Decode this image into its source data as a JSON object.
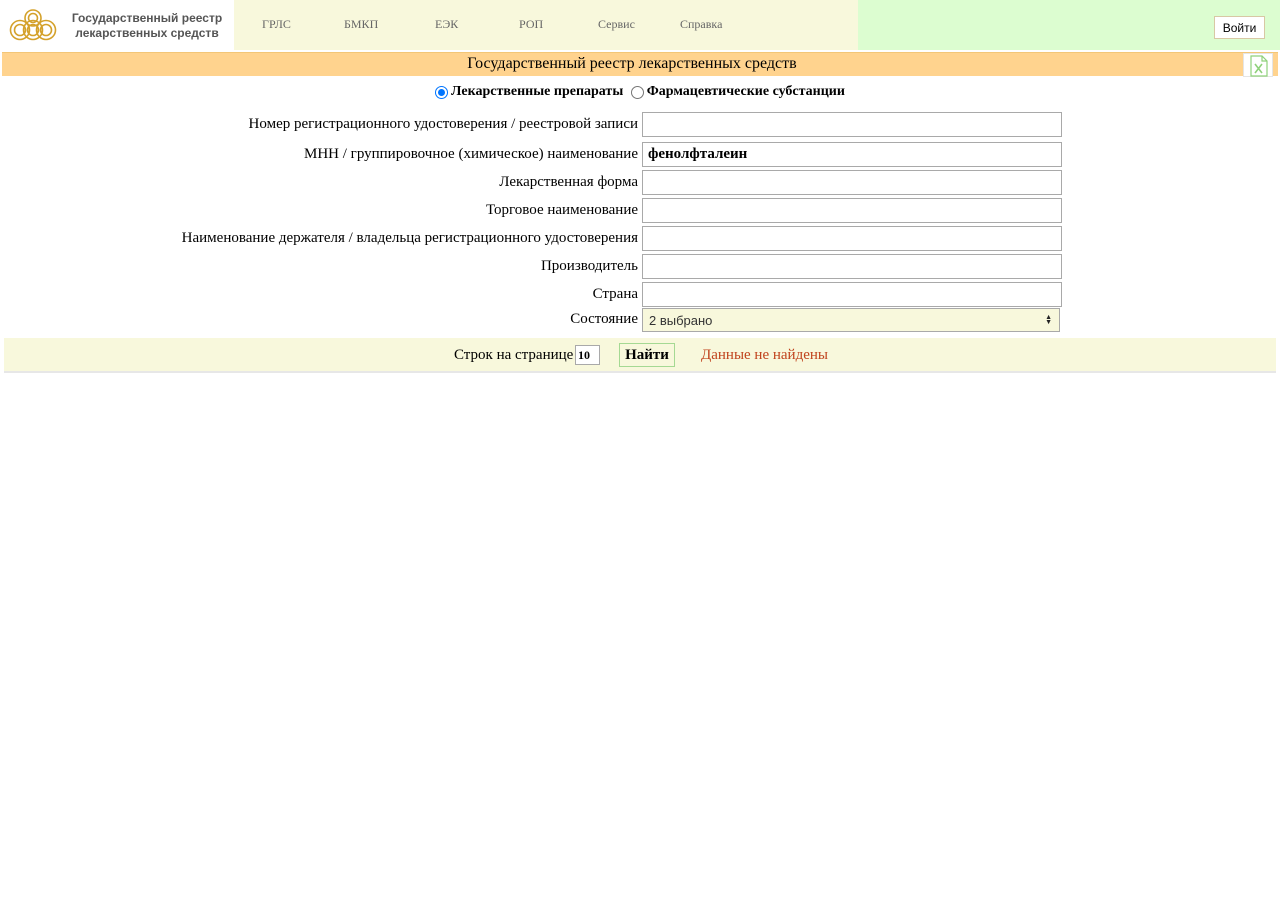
{
  "header": {
    "logo_line1": "Государственный реестр",
    "logo_line2": "лекарственных средств",
    "nav": [
      "ГРЛС",
      "БМКП",
      "ЕЭК",
      "РОП",
      "Сервис",
      "Справка"
    ],
    "login_label": "Войти"
  },
  "title_bar": {
    "title": "Государственный реестр лекарственных средств",
    "export_icon": "excel-icon"
  },
  "type_selector": {
    "options": [
      {
        "label": "Лекарственные препараты",
        "checked": true
      },
      {
        "label": "Фармацевтические субстанции",
        "checked": false
      }
    ]
  },
  "form": {
    "reg_number": {
      "label": "Номер регистрационного удостоверения / реестровой записи",
      "value": ""
    },
    "inn": {
      "label": "МНН / группировочное (химическое) наименование",
      "value": "фенолфталеин"
    },
    "dosage_form": {
      "label": "Лекарственная форма",
      "value": ""
    },
    "trade_name": {
      "label": "Торговое наименование",
      "value": ""
    },
    "holder": {
      "label": "Наименование держателя / владельца регистрационного удостоверения",
      "value": ""
    },
    "manufacturer": {
      "label": "Производитель",
      "value": ""
    },
    "country": {
      "label": "Страна",
      "value": ""
    },
    "state": {
      "label": "Состояние",
      "value": "2 выбрано"
    }
  },
  "footer": {
    "rows_label": "Строк на странице",
    "rows_value": "10",
    "find_label": "Найти",
    "status": "Данные не найдены"
  },
  "colors": {
    "nav_bg": "#f8f8dc",
    "right_bg": "#dcfdd0",
    "title_bg": "#ffd38e",
    "status": "#c0431d",
    "logo": "#d4a12a"
  }
}
